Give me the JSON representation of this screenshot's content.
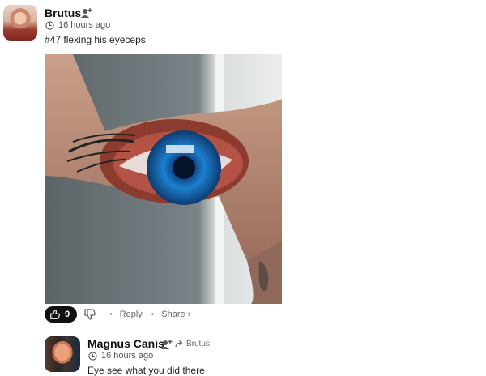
{
  "post": {
    "author": "Brutus",
    "timestamp": "16 hours ago",
    "text": "#47 flexing his eyeceps",
    "image_alt": "arm with eye tattoo",
    "likes": "9",
    "reply_label": "Reply",
    "share_label": "Share ›"
  },
  "reply": {
    "author": "Magnus Canis",
    "reply_to": "Brutus",
    "timestamp": "16 hours ago",
    "text": "Eye see what you did there"
  },
  "icons": {
    "follow": "person-plus-icon",
    "clock": "clock-icon",
    "like": "thumbs-up-icon",
    "dislike": "thumbs-down-icon",
    "reply_arrow": "reply-arrow-icon"
  },
  "colors": {
    "like_pill": "#111111",
    "iris": "#1c7fd0"
  }
}
